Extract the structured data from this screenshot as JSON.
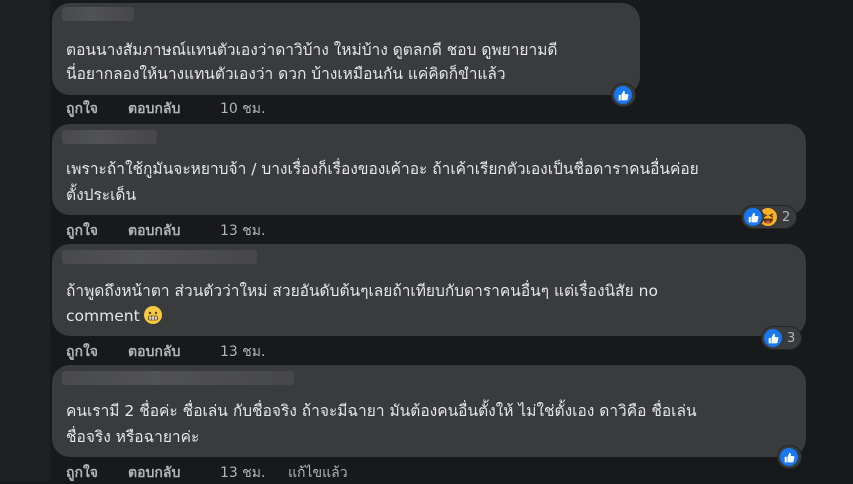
{
  "comments": [
    {
      "lines": [
        "ตอนนางสัมภาษณ์แทนตัวเองว่าดาวิบ้าง ใหม่บ้าง ดูตลกดี ชอบ ดูพยายามดี",
        "นี่อยากลองให้นางแทนตัวเองว่า ดวก บ้างเหมือนกัน แค่คิดก็ขำแล้ว"
      ],
      "like_label": "ถูกใจ",
      "reply_label": "ตอบกลับ",
      "time": "10 ชม.",
      "reaction_icons": [
        "like-icon"
      ],
      "reaction_count": ""
    },
    {
      "lines": [
        "เพราะถ้าใช้กูมันจะหยาบจ้า / บางเรื่องก็เรื่องของเค้าอะ ถ้าเค้าเรียกตัวเองเป็นชื่อดาราคนอื่นค่อย",
        "ตั้งประเด็น"
      ],
      "like_label": "ถูกใจ",
      "reply_label": "ตอบกลับ",
      "time": "13 ชม.",
      "reaction_icons": [
        "like-icon",
        "haha-icon"
      ],
      "reaction_count": "2"
    },
    {
      "lines": [
        "ถ้าพูดถึงหน้าตา ส่วนตัวว่าใหม่ สวยอันดับต้นๆเลยถ้าเทียบกับดาราคนอื่นๆ แต่เรื่องนิสัย no",
        "comment"
      ],
      "like_label": "ถูกใจ",
      "reply_label": "ตอบกลับ",
      "time": "13 ชม.",
      "reaction_icons": [
        "like-icon"
      ],
      "reaction_count": "3",
      "inline_emoji": "grimacing-emoji-icon"
    },
    {
      "lines": [
        "คนเรามี 2 ชื่อค่ะ ชื่อเล่น กับชื่อจริง ถ้าจะมีฉายา มันต้องคนอื่นตั้งให้ ไม่ใช่ตั้งเอง ดาวิคือ ชื่อเล่น",
        "ชื่อจริง หรือฉายาค่ะ"
      ],
      "like_label": "ถูกใจ",
      "reply_label": "ตอบกลับ",
      "time": "13 ชม.",
      "edited_label": "แก้ไขแล้ว",
      "reaction_icons": [
        "like-icon"
      ],
      "reaction_count": ""
    }
  ],
  "colors": {
    "background": "#18191a",
    "bubble": "#3a3b3c",
    "text": "#e4e6eb",
    "secondary": "#b0b3b8",
    "like": "#1877f2",
    "haha": "#f7b125"
  }
}
